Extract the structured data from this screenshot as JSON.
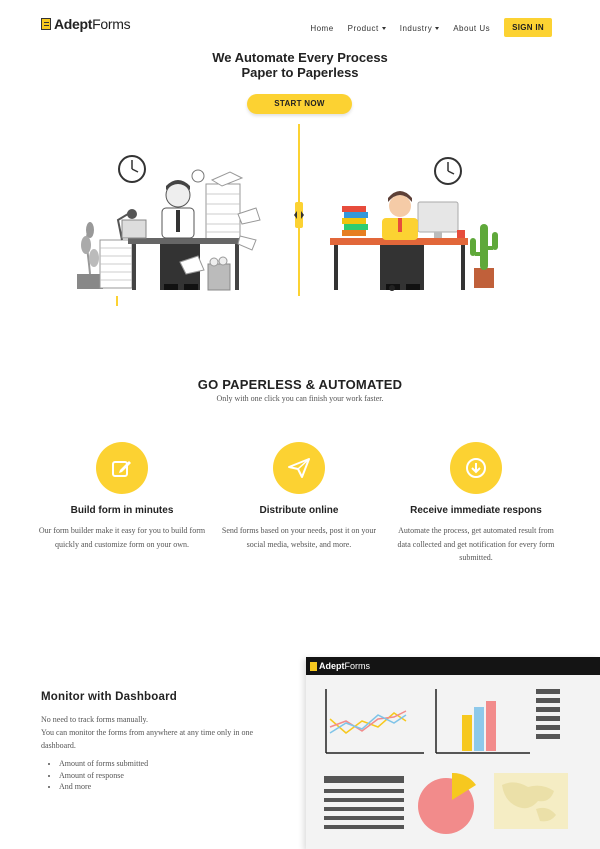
{
  "nav": {
    "logo_bold": "Adept",
    "logo_light": "Forms",
    "items": [
      {
        "label": "Home",
        "dropdown": false
      },
      {
        "label": "Product",
        "dropdown": true
      },
      {
        "label": "Industry",
        "dropdown": true
      },
      {
        "label": "About Us",
        "dropdown": false
      }
    ],
    "signin_label": "SIGN IN"
  },
  "hero": {
    "title_line1": "We Automate Every Process",
    "title_line2": "Paper to Paperless",
    "cta_label": "START NOW"
  },
  "features_section": {
    "title": "GO PAPERLESS & AUTOMATED",
    "subtitle": "Only with one click you can finish your work faster.",
    "items": [
      {
        "icon": "edit-icon",
        "title": "Build form in minutes",
        "desc": "Our form builder make it easy for you to build form quickly and customize form on your own."
      },
      {
        "icon": "send-icon",
        "title": "Distribute online",
        "desc": "Send forms based on your needs, post it on your social media, website, and more."
      },
      {
        "icon": "download-icon",
        "title": "Receive immediate respons",
        "desc": "Automate the process, get automated result from data collected and get notification for every form submitted."
      }
    ]
  },
  "dashboard": {
    "title": "Monitor with Dashboard",
    "desc_line1": "No need to track forms manually.",
    "desc_line2": "You can monitor the forms from anywhere at any time only in one dashboard.",
    "bullets": [
      "Amount of forms submitted",
      "Amount of response",
      "And more"
    ],
    "panel_logo_bold": "Adept",
    "panel_logo_light": "Forms"
  },
  "colors": {
    "accent": "#fcd232",
    "dark": "#222222"
  }
}
